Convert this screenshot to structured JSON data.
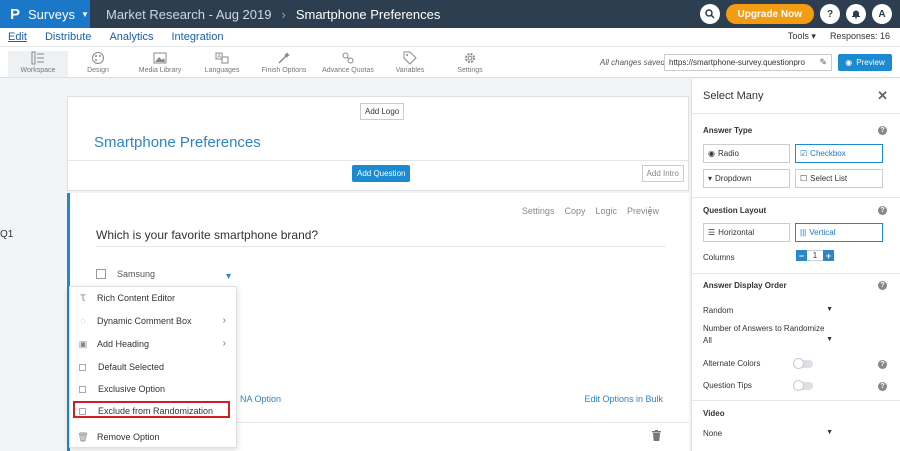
{
  "topbar": {
    "logo": "P",
    "product": "Surveys",
    "breadcrumb_parent": "Market Research - Aug 2019",
    "breadcrumb_current": "Smartphone Preferences",
    "upgrade_label": "Upgrade Now",
    "help_label": "?",
    "avatar_label": "A"
  },
  "menubar": {
    "items": [
      "Edit",
      "Distribute",
      "Analytics",
      "Integration"
    ],
    "tools_label": "Tools ▾",
    "responses_label": "Responses: 16"
  },
  "toolbar": {
    "tools": [
      "Workspace",
      "Design",
      "Media Library",
      "Languages",
      "Finish Options",
      "Advance Quotas",
      "Variables",
      "Settings"
    ],
    "saved_status": "All changes saved",
    "survey_url": "https://smartphone-survey.questionpro",
    "preview_label": "Preview"
  },
  "header_card": {
    "add_logo_label": "Add Logo",
    "survey_title": "Smartphone Preferences",
    "add_question_label": "Add Question",
    "add_intro_label": "Add Intro"
  },
  "question": {
    "number": "Q1",
    "actions": [
      "Settings",
      "Copy",
      "Logic",
      "Preview"
    ],
    "text": "Which is your favorite smartphone brand?",
    "option": "Samsung",
    "na_option_label": "NA Option",
    "bulk_label": "Edit Options in Bulk"
  },
  "context_menu": {
    "items": [
      "Rich Content Editor",
      "Dynamic Comment Box",
      "Add Heading",
      "Default Selected",
      "Exclusive Option",
      "Exclude from Randomization",
      "Remove Option"
    ]
  },
  "right_panel": {
    "title": "Select Many",
    "answer_type_label": "Answer Type",
    "answer_types": [
      "Radio",
      "Checkbox",
      "Dropdown",
      "Select List"
    ],
    "question_layout_label": "Question Layout",
    "layouts": [
      "Horizontal",
      "Vertical"
    ],
    "columns_label": "Columns",
    "columns_value": "1",
    "display_order_label": "Answer Display Order",
    "display_order_value": "Random",
    "num_randomize_label": "Number of Answers to Randomize",
    "num_randomize_value": "All",
    "alternate_colors_label": "Alternate Colors",
    "question_tips_label": "Question Tips",
    "video_label": "Video",
    "video_value": "None"
  },
  "colors": {
    "topbar": "#2c3e50",
    "brand": "#1b78c8",
    "accent": "#1b8ad0",
    "upgrade": "#f39c12",
    "highlight": "#d21f27"
  }
}
